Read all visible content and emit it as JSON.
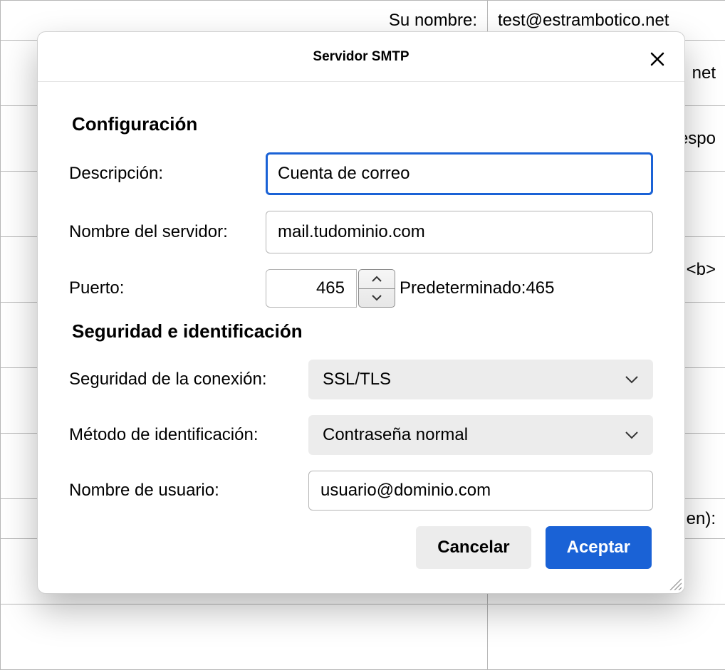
{
  "background": {
    "rows": [
      {
        "label": "Su nombre:",
        "value": "test@estrambotico.net"
      },
      {
        "label": "",
        "value": "net"
      },
      {
        "label": "",
        "value": "espo"
      },
      {
        "label": "",
        "value": ""
      },
      {
        "label": "",
        "value": "<b>"
      },
      {
        "label": "",
        "value": ""
      },
      {
        "label": "",
        "value": ""
      },
      {
        "label": "",
        "value": ""
      },
      {
        "label": "",
        "value": "en):"
      },
      {
        "label": "",
        "value": ""
      },
      {
        "label": "",
        "value": ""
      }
    ]
  },
  "dialog": {
    "title": "Servidor SMTP",
    "section_config": "Configuración",
    "desc_label": "Descripción:",
    "desc_value": "Cuenta de correo",
    "server_label": "Nombre del servidor:",
    "server_value": "mail.tudominio.com",
    "port_label": "Puerto:",
    "port_value": "465",
    "port_default_label": "Predeterminado:",
    "port_default_value": "465",
    "section_security": "Seguridad e identificación",
    "conn_sec_label": "Seguridad de la conexión:",
    "conn_sec_value": "SSL/TLS",
    "auth_label": "Método de identificación:",
    "auth_value": "Contraseña normal",
    "user_label": "Nombre de usuario:",
    "user_value": "usuario@dominio.com",
    "cancel": "Cancelar",
    "accept": "Aceptar"
  }
}
